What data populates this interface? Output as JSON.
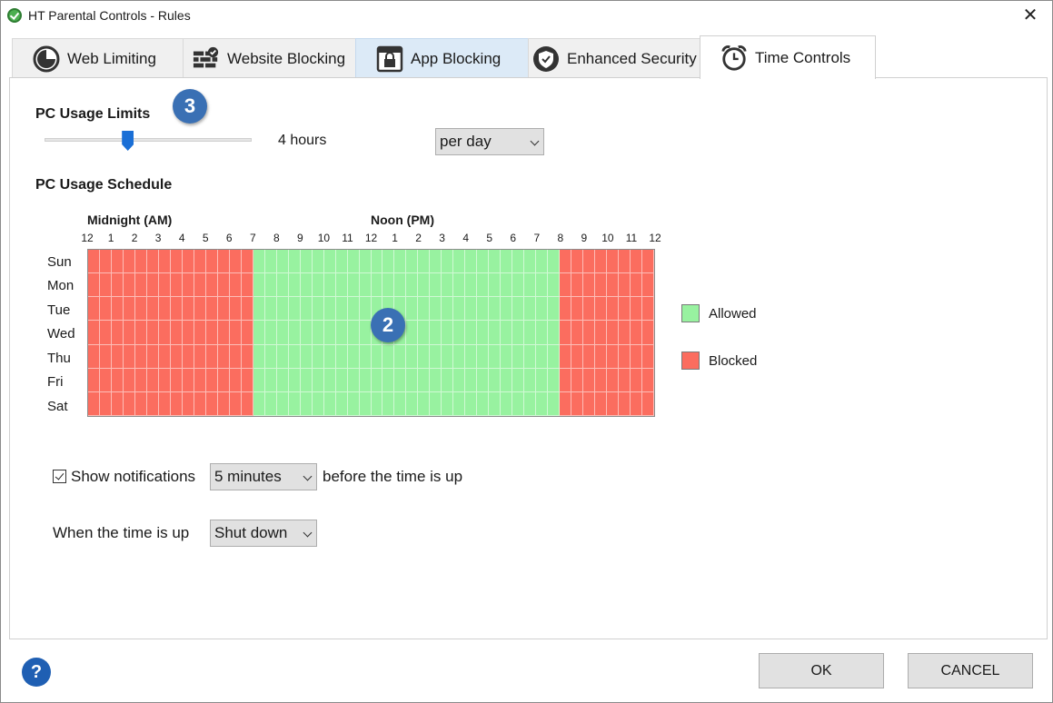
{
  "window": {
    "title": "HT Parental Controls - Rules",
    "close_label": "✕"
  },
  "tabs": [
    {
      "label": "Web Limiting",
      "icon": "gauge-icon"
    },
    {
      "label": "Website Blocking",
      "icon": "firewall-icon"
    },
    {
      "label": "App Blocking",
      "icon": "app-lock-icon"
    },
    {
      "label": "Enhanced Security",
      "icon": "shield-icon"
    },
    {
      "label": "Time Controls",
      "icon": "alarm-clock-icon"
    }
  ],
  "active_tab": "Time Controls",
  "usage_limits": {
    "heading": "PC Usage Limits",
    "badge": "3",
    "slider_fraction": 0.4,
    "value_text": "4 hours",
    "period_dropdown": "per day"
  },
  "schedule": {
    "heading": "PC Usage Schedule",
    "badge": "2",
    "am_label": "Midnight (AM)",
    "pm_label": "Noon (PM)",
    "hour_labels": [
      "12",
      "1",
      "2",
      "3",
      "4",
      "5",
      "6",
      "7",
      "8",
      "9",
      "10",
      "11",
      "12",
      "1",
      "2",
      "3",
      "4",
      "5",
      "6",
      "7",
      "8",
      "9",
      "10",
      "11",
      "12"
    ],
    "days": [
      "Sun",
      "Mon",
      "Tue",
      "Wed",
      "Thu",
      "Fri",
      "Sat"
    ],
    "allowed_start_hour": 7,
    "allowed_end_hour": 20,
    "colors": {
      "allowed": "#98f2a0",
      "blocked": "#fb6d5f"
    }
  },
  "legend": {
    "allowed": "Allowed",
    "blocked": "Blocked"
  },
  "notifications": {
    "checkbox_label": "Show notifications",
    "checked": true,
    "interval": "5 minutes",
    "suffix": "before the time is up"
  },
  "time_up": {
    "label": "When the time is up",
    "action": "Shut down"
  },
  "footer": {
    "help": "?",
    "ok": "OK",
    "cancel": "CANCEL"
  }
}
